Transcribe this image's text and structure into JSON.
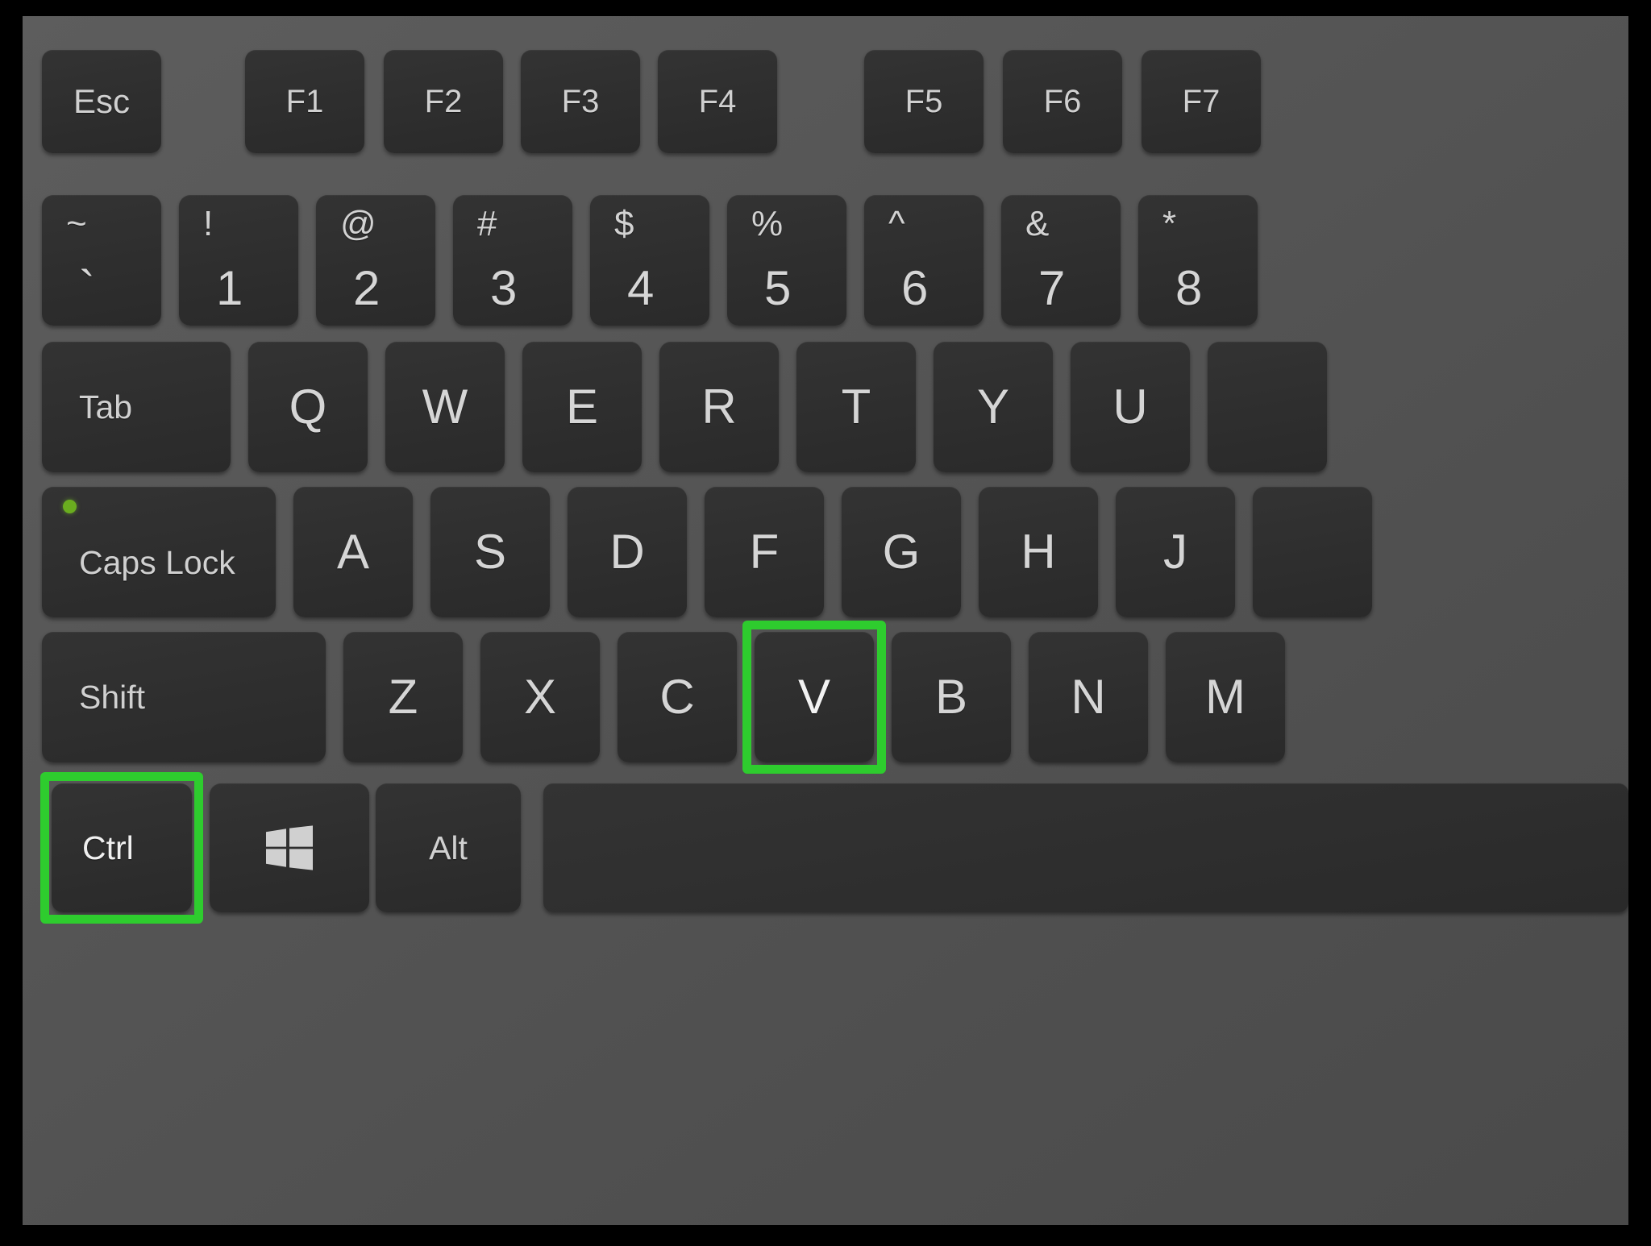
{
  "image": {
    "subject": "laptop-keyboard",
    "description": "Close-up of a dark laptop keyboard with Ctrl and V keys outlined in green",
    "shortcut": "Ctrl + V"
  },
  "colors": {
    "outer_background": "#000000",
    "deck_background": "#565656",
    "keycap": "#2f2f2f",
    "key_text": "#d2d2d2",
    "highlight_green": "#2ecc2e",
    "caps_led_green": "#6aad1f"
  },
  "rows": {
    "function_row": [
      {
        "label": "Esc",
        "type": "mod"
      },
      {
        "label": "F1",
        "type": "fn"
      },
      {
        "label": "F2",
        "type": "fn"
      },
      {
        "label": "F3",
        "type": "fn"
      },
      {
        "label": "F4",
        "type": "fn"
      },
      {
        "label": "F5",
        "type": "fn"
      },
      {
        "label": "F6",
        "type": "fn"
      },
      {
        "label": "F7",
        "type": "fn"
      }
    ],
    "number_row": [
      {
        "top": "~",
        "bottom": "`"
      },
      {
        "top": "!",
        "bottom": "1"
      },
      {
        "top": "@",
        "bottom": "2"
      },
      {
        "top": "#",
        "bottom": "3"
      },
      {
        "top": "$",
        "bottom": "4"
      },
      {
        "top": "%",
        "bottom": "5"
      },
      {
        "top": "^",
        "bottom": "6"
      },
      {
        "top": "&",
        "bottom": "7"
      },
      {
        "top": "*",
        "bottom": "8"
      }
    ],
    "tab_row": [
      {
        "label": "Tab",
        "type": "mod"
      },
      {
        "label": "Q",
        "type": "letter"
      },
      {
        "label": "W",
        "type": "letter"
      },
      {
        "label": "E",
        "type": "letter"
      },
      {
        "label": "R",
        "type": "letter"
      },
      {
        "label": "T",
        "type": "letter"
      },
      {
        "label": "Y",
        "type": "letter"
      },
      {
        "label": "U",
        "type": "letter"
      }
    ],
    "caps_row": [
      {
        "label": "Caps Lock",
        "type": "mod",
        "led": true
      },
      {
        "label": "A",
        "type": "letter"
      },
      {
        "label": "S",
        "type": "letter"
      },
      {
        "label": "D",
        "type": "letter"
      },
      {
        "label": "F",
        "type": "letter"
      },
      {
        "label": "G",
        "type": "letter"
      },
      {
        "label": "H",
        "type": "letter"
      },
      {
        "label": "J",
        "type": "letter"
      }
    ],
    "shift_row": [
      {
        "label": "Shift",
        "type": "mod"
      },
      {
        "label": "Z",
        "type": "letter"
      },
      {
        "label": "X",
        "type": "letter"
      },
      {
        "label": "C",
        "type": "letter"
      },
      {
        "label": "V",
        "type": "letter",
        "highlighted": true
      },
      {
        "label": "B",
        "type": "letter"
      },
      {
        "label": "N",
        "type": "letter"
      },
      {
        "label": "M",
        "type": "letter"
      }
    ],
    "bottom_row": [
      {
        "label": "Ctrl",
        "type": "mod",
        "highlighted": true
      },
      {
        "label": "",
        "type": "windows",
        "icon": "windows-logo-icon"
      },
      {
        "label": "Alt",
        "type": "mod"
      },
      {
        "label": "",
        "type": "space"
      }
    ]
  }
}
